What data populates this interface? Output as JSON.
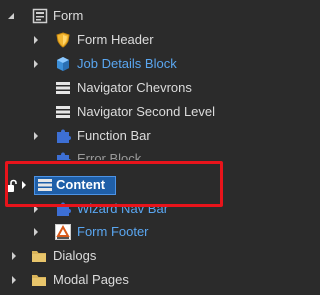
{
  "tree": {
    "form": {
      "label": "Form",
      "icon": "form-icon"
    },
    "form_header": {
      "label": "Form Header",
      "icon": "shield-icon"
    },
    "job_details_block": {
      "label": "Job Details Block",
      "icon": "cube-icon"
    },
    "navigator_chevrons": {
      "label": "Navigator Chevrons",
      "icon": "list-icon"
    },
    "navigator_second_level": {
      "label": "Navigator Second Level",
      "icon": "list-icon"
    },
    "function_bar": {
      "label": "Function Bar",
      "icon": "puzzle-icon"
    },
    "error_block": {
      "label": "Error Block",
      "icon": "puzzle-icon"
    },
    "content": {
      "label": "Content",
      "icon": "list-icon",
      "locked": "unlocked"
    },
    "wizard_nav_bar": {
      "label": "Wizard Nav Bar",
      "icon": "puzzle-icon"
    },
    "form_footer": {
      "label": "Form Footer",
      "icon": "footer-icon"
    },
    "dialogs": {
      "label": "Dialogs",
      "icon": "folder-icon"
    },
    "modal_pages": {
      "label": "Modal Pages",
      "icon": "folder-icon"
    }
  },
  "colors": {
    "background": "#2b2b2b",
    "text": "#dcdcdc",
    "link": "#5aa6f0",
    "selection": "#1f5fa8",
    "highlight": "#e8141b"
  }
}
